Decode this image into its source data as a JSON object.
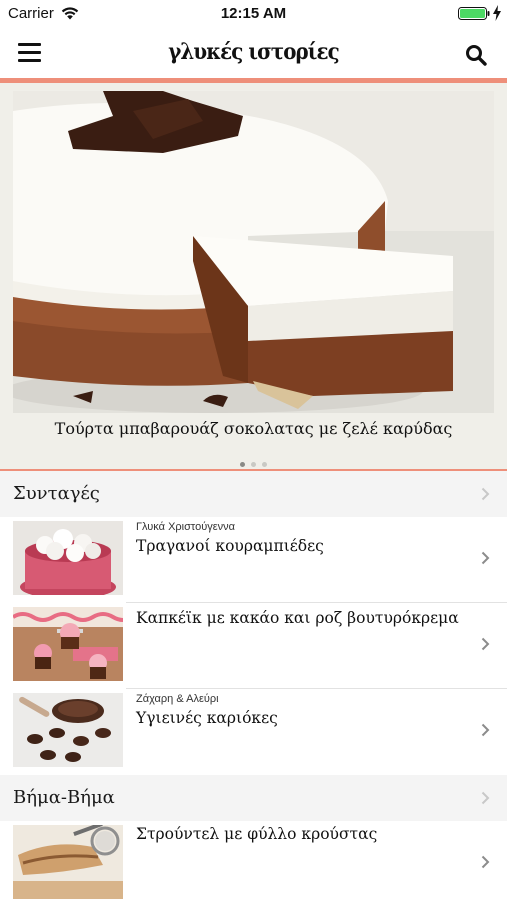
{
  "status_bar": {
    "carrier": "Carrier",
    "time": "12:15 AM",
    "wifi_icon": "wifi-icon",
    "battery_icon": "battery-icon",
    "battery_color": "#4cd964"
  },
  "nav": {
    "brand": "γλυκές ιστορίες",
    "menu_icon": "hamburger-menu-icon",
    "search_icon": "search-icon",
    "accent_color": "#ee8f7a"
  },
  "hero": {
    "caption": "Τούρτα μπαβαρουάζ σοκολατας με ζελέ καρύδας",
    "page_count": 3,
    "active_page": 1
  },
  "sections": [
    {
      "title": "Συνταγές",
      "items": [
        {
          "category": "Γλυκά Χριστούγεννα",
          "title": "Τραγανοί κουραμπιέδες"
        },
        {
          "category": "",
          "title": "Καπκέϊκ με κακάο και ροζ βουτυρόκρεμα"
        },
        {
          "category": "Ζάχαρη & Αλεύρι",
          "title": "Υγιεινές καριόκες"
        }
      ]
    },
    {
      "title": "Βήμα-Βήμα",
      "items": [
        {
          "category": "",
          "title": "Στρούντελ με φύλλο κρούστας"
        }
      ]
    }
  ]
}
